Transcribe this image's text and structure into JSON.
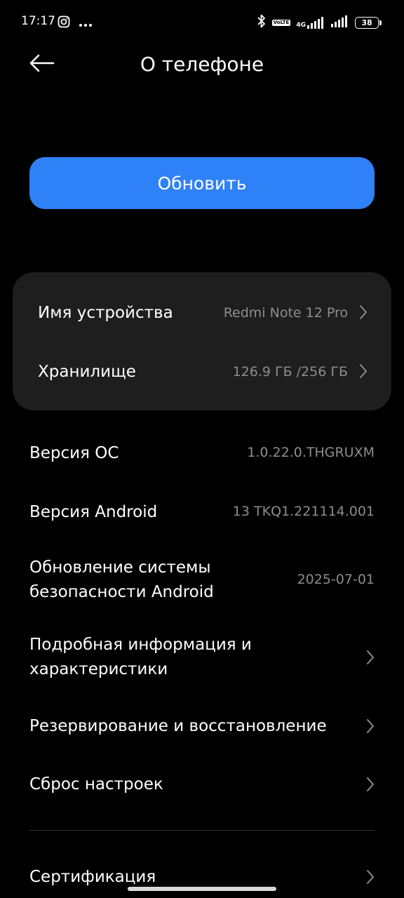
{
  "status_bar": {
    "time": "17:17",
    "left_icons": [
      "instagram-icon",
      "more-dots-icon"
    ],
    "right_icons": [
      "bluetooth-icon",
      "volte-icon",
      "signal-4g-icon",
      "signal-icon",
      "battery-icon"
    ],
    "volte_text": "Vo\nLTE",
    "network": "4G",
    "battery": "38"
  },
  "header": {
    "title": "О телефоне",
    "back_icon": "arrow-left-icon"
  },
  "update_button": {
    "label": "Обновить",
    "color": "#2f81f7"
  },
  "card": {
    "items": [
      {
        "label": "Имя устройства",
        "value": "Redmi Note 12 Pro"
      },
      {
        "label": "Хранилище",
        "value": "126.9 ГБ /256 ГБ"
      }
    ]
  },
  "info": {
    "os_version": {
      "label": "Версия ОС",
      "value": "1.0.22.0.THGRUXM"
    },
    "android_version": {
      "label": "Версия Android",
      "value": "13 TKQ1.221114.001"
    },
    "security_update": {
      "label_line1": "Обновление системы",
      "label_line2": "безопасности Android",
      "value": "2025-07-01"
    }
  },
  "links": {
    "details": {
      "label_line1": "Подробная информация и",
      "label_line2": "характеристики"
    },
    "backup": {
      "label": "Резервирование и восстановление"
    },
    "reset": {
      "label": "Сброс настроек"
    },
    "certification": {
      "label": "Сертификация"
    }
  },
  "colors": {
    "background": "#000000",
    "card": "#1e1e1e",
    "secondary_text": "#8d8d8d",
    "accent": "#2f81f7"
  }
}
